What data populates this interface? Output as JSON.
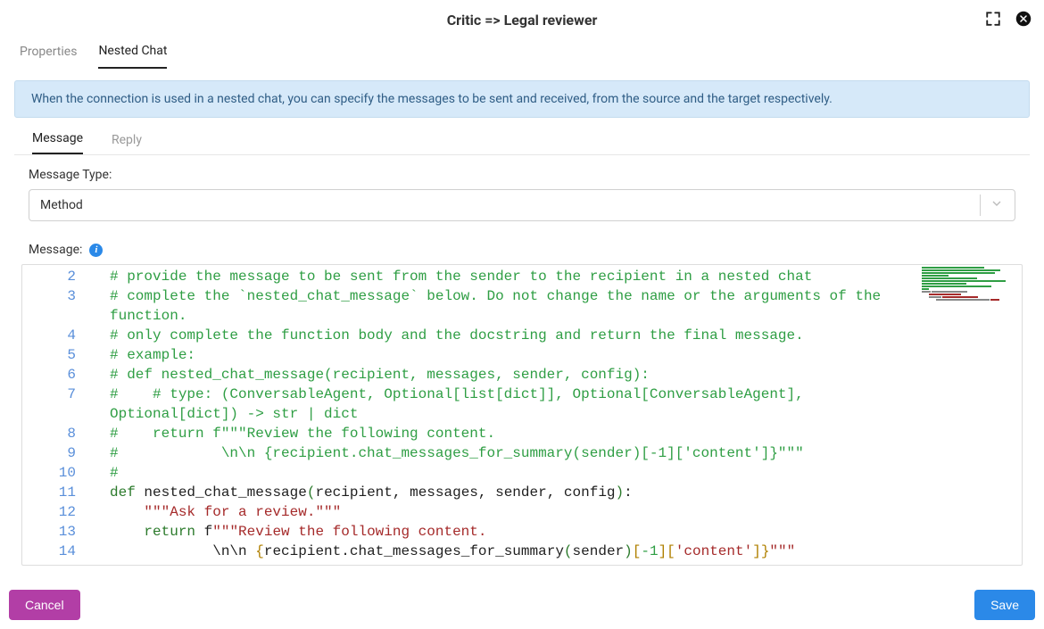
{
  "header": {
    "title": "Critic => Legal reviewer"
  },
  "tabs": {
    "properties": "Properties",
    "nested_chat": "Nested Chat"
  },
  "info_banner": "When the connection is used in a nested chat, you can specify the messages to be sent and received, from the source and the target respectively.",
  "subtabs": {
    "message": "Message",
    "reply": "Reply"
  },
  "form": {
    "message_type_label": "Message Type:",
    "message_type_value": "Method",
    "message_label": "Message:"
  },
  "code": {
    "lines": [
      {
        "n": 2,
        "type": "comment",
        "text": "# provide the message to be sent from the sender to the recipient in a nested chat"
      },
      {
        "n": 3,
        "type": "comment",
        "text": "# complete the `nested_chat_message` below. Do not change the name or the arguments of the function."
      },
      {
        "n": 4,
        "type": "comment",
        "text": "# only complete the function body and the docstring and return the final message."
      },
      {
        "n": 5,
        "type": "comment",
        "text": "# example:"
      },
      {
        "n": 6,
        "type": "comment",
        "text": "# def nested_chat_message(recipient, messages, sender, config):"
      },
      {
        "n": 7,
        "type": "comment",
        "text": "#    # type: (ConversableAgent, Optional[list[dict]], Optional[ConversableAgent], Optional[dict]) -> str | dict"
      },
      {
        "n": 8,
        "type": "comment",
        "text": "#    return f\"\"\"Review the following content."
      },
      {
        "n": 9,
        "type": "comment",
        "text": "#            \\n\\n {recipient.chat_messages_for_summary(sender)[-1]['content']}\"\"\""
      },
      {
        "n": 10,
        "type": "comment",
        "text": "#"
      },
      {
        "n": 11,
        "type": "def",
        "kw": "def",
        "name": "nested_chat_message",
        "args": "recipient, messages, sender, config"
      },
      {
        "n": 12,
        "type": "docstr",
        "text": "\"\"\"Ask for a review.\"\"\""
      },
      {
        "n": 13,
        "type": "return1",
        "kw": "return",
        "prefix": "f",
        "str": "\"\"\"Review the following content."
      },
      {
        "n": 14,
        "type": "return2",
        "lead": "\\n\\n ",
        "ident": "recipient",
        "method": "chat_messages_for_summary",
        "arg": "sender",
        "idx": "-1",
        "key": "'content'",
        "tail": "\"\"\""
      }
    ]
  },
  "footer": {
    "cancel": "Cancel",
    "save": "Save"
  }
}
